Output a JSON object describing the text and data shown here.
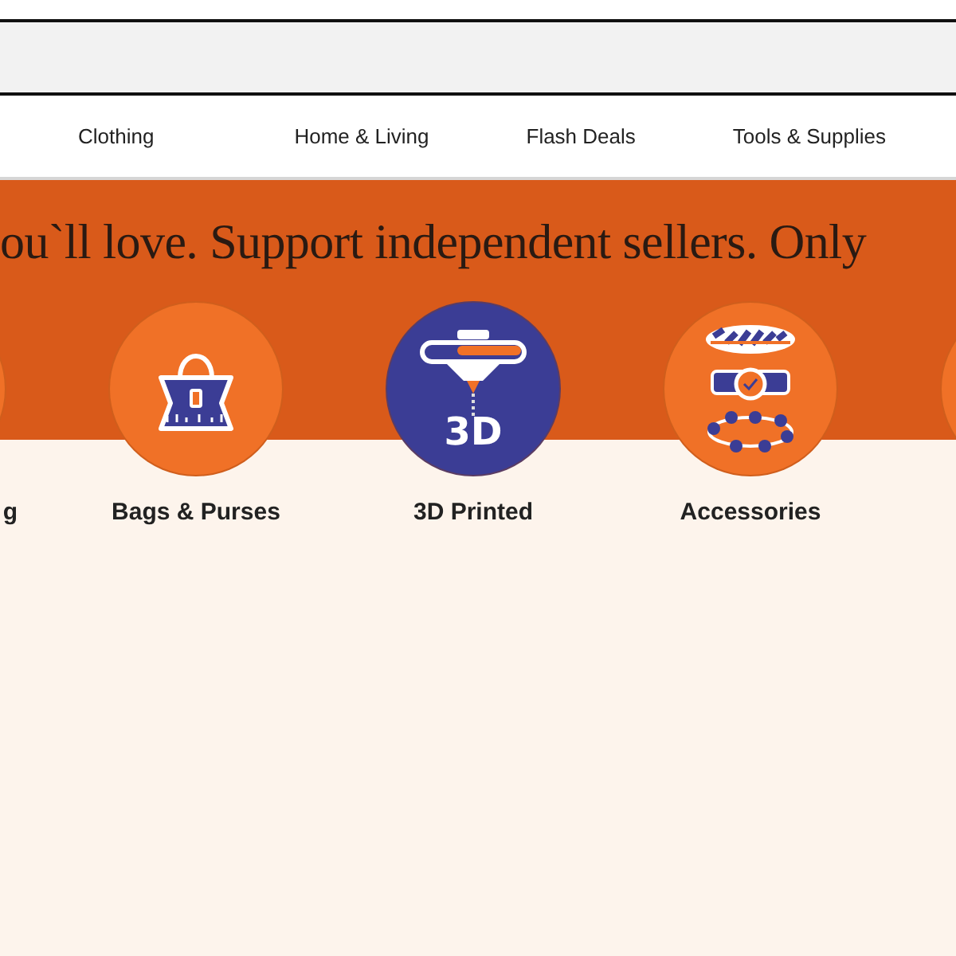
{
  "search_bar": {
    "kind": "empty"
  },
  "nav": {
    "items": [
      {
        "label": "Clothing"
      },
      {
        "label": "Home & Living"
      },
      {
        "label": "Flash Deals"
      },
      {
        "label": "Tools & Supplies"
      }
    ]
  },
  "banner": {
    "headline": "ou`ll love. Support independent sellers. Only"
  },
  "categories": [
    {
      "kind": "edge",
      "label": "g",
      "color": "#f07127"
    },
    {
      "kind": "bag",
      "label": "Bags & Purses",
      "color": "#f07127"
    },
    {
      "kind": "printer",
      "label": "3D Printed",
      "color": "#3b3d95",
      "badge": "3D"
    },
    {
      "kind": "jewelry",
      "label": "Accessories",
      "color": "#f07127"
    },
    {
      "kind": "edge",
      "color": "#f07127"
    }
  ]
}
